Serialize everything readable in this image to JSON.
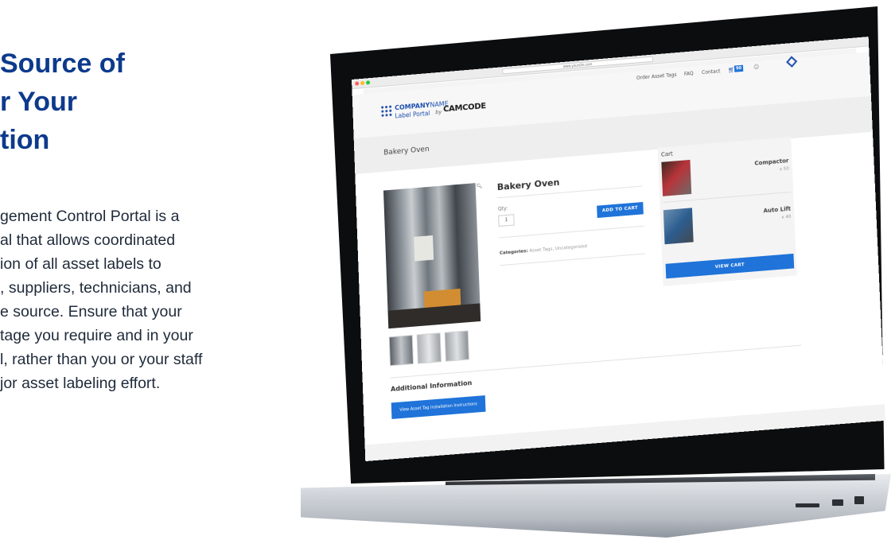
{
  "hero": {
    "heading_lines": [
      "Source of",
      "r Your",
      "tion"
    ],
    "body_lines": [
      "gement Control Portal is a",
      "al that allows coordinated",
      "ion of all asset labels to",
      ", suppliers, technicians, and",
      "e source. Ensure that your",
      "tage you require and in your",
      "l, rather than you or your staff",
      "jor asset labeling effort."
    ]
  },
  "browser": {
    "url": "www.yoursite.com"
  },
  "site": {
    "logo": {
      "company": "COMPANY",
      "name": "NAME",
      "sub": "Label Portal",
      "by": "by",
      "brand": "CAMCODE"
    },
    "nav": {
      "order_asset_tags": "Order Asset Tags",
      "faq": "FAQ",
      "contact": "Contact",
      "cart_count": "90"
    },
    "page_title": "Bakery Oven",
    "product": {
      "name": "Bakery Oven",
      "qty_label": "Qty:",
      "qty_value": "1",
      "add_to_cart": "ADD TO CART",
      "categories_label": "Categories:",
      "categories_value": "Asset Tags, Uncategorized"
    },
    "cart": {
      "title": "Cart",
      "items": [
        {
          "name": "Compactor",
          "qty": "x 50"
        },
        {
          "name": "Auto Lift",
          "qty": "x 40"
        }
      ],
      "view_cart": "VIEW CART"
    },
    "additional_info": {
      "heading": "Additional Information",
      "button": "View Asset Tag Installation Instructions"
    }
  },
  "colors": {
    "hero_heading": "#0d3a8c",
    "accent_blue": "#1f73d9",
    "brand_blue": "#1f4fae"
  }
}
